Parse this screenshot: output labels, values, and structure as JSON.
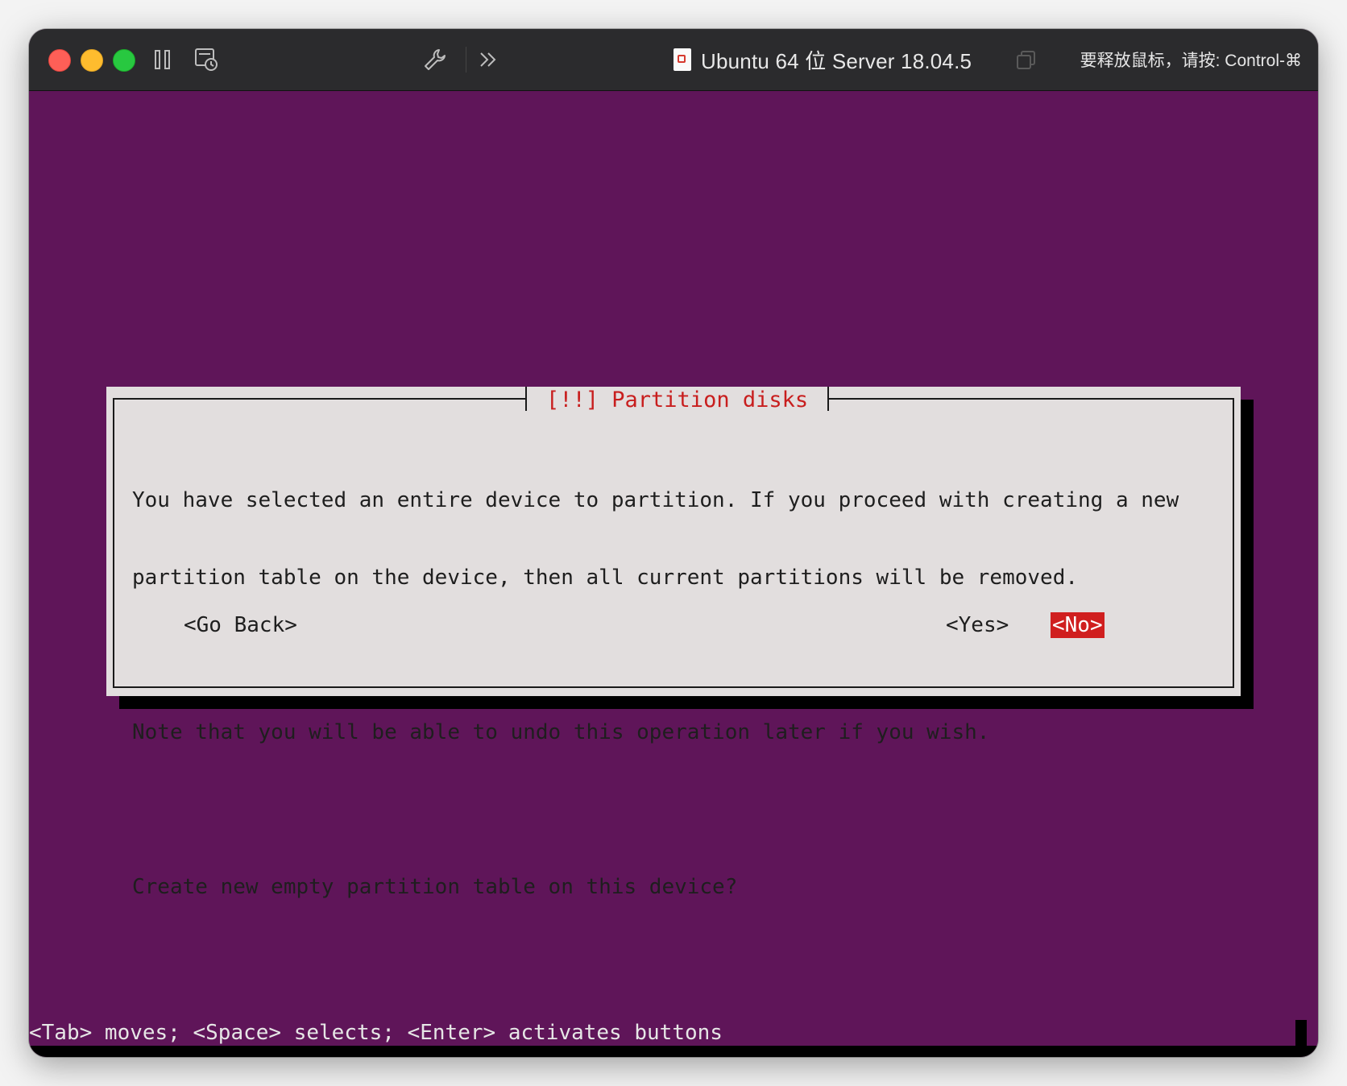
{
  "window": {
    "title": "Ubuntu 64 位 Server 18.04.5",
    "release_hint": "要释放鼠标，请按: Control-⌘"
  },
  "toolbar": {
    "icons": [
      "pause-icon",
      "snapshot-icon",
      "settings-wrench-icon",
      "more-chevron-icon",
      "copy-window-icon",
      "vm-document-icon"
    ]
  },
  "dialog": {
    "title": "[!!] Partition disks",
    "body_lines": [
      "You have selected an entire device to partition. If you proceed with creating a new",
      "partition table on the device, then all current partitions will be removed.",
      "",
      "Note that you will be able to undo this operation later if you wish.",
      "",
      "Create new empty partition table on this device?"
    ],
    "buttons": {
      "go_back": "<Go Back>",
      "yes": "<Yes>",
      "no": "<No>"
    },
    "selected_button": "no"
  },
  "help_bar": "<Tab> moves; <Space> selects; <Enter> activates buttons",
  "colors": {
    "console_bg": "#5f1559",
    "dialog_bg": "#e2dede",
    "title_red": "#c81e1e",
    "selected_button_bg": "#d01f1f",
    "titlebar_bg": "#2b2b2d"
  }
}
